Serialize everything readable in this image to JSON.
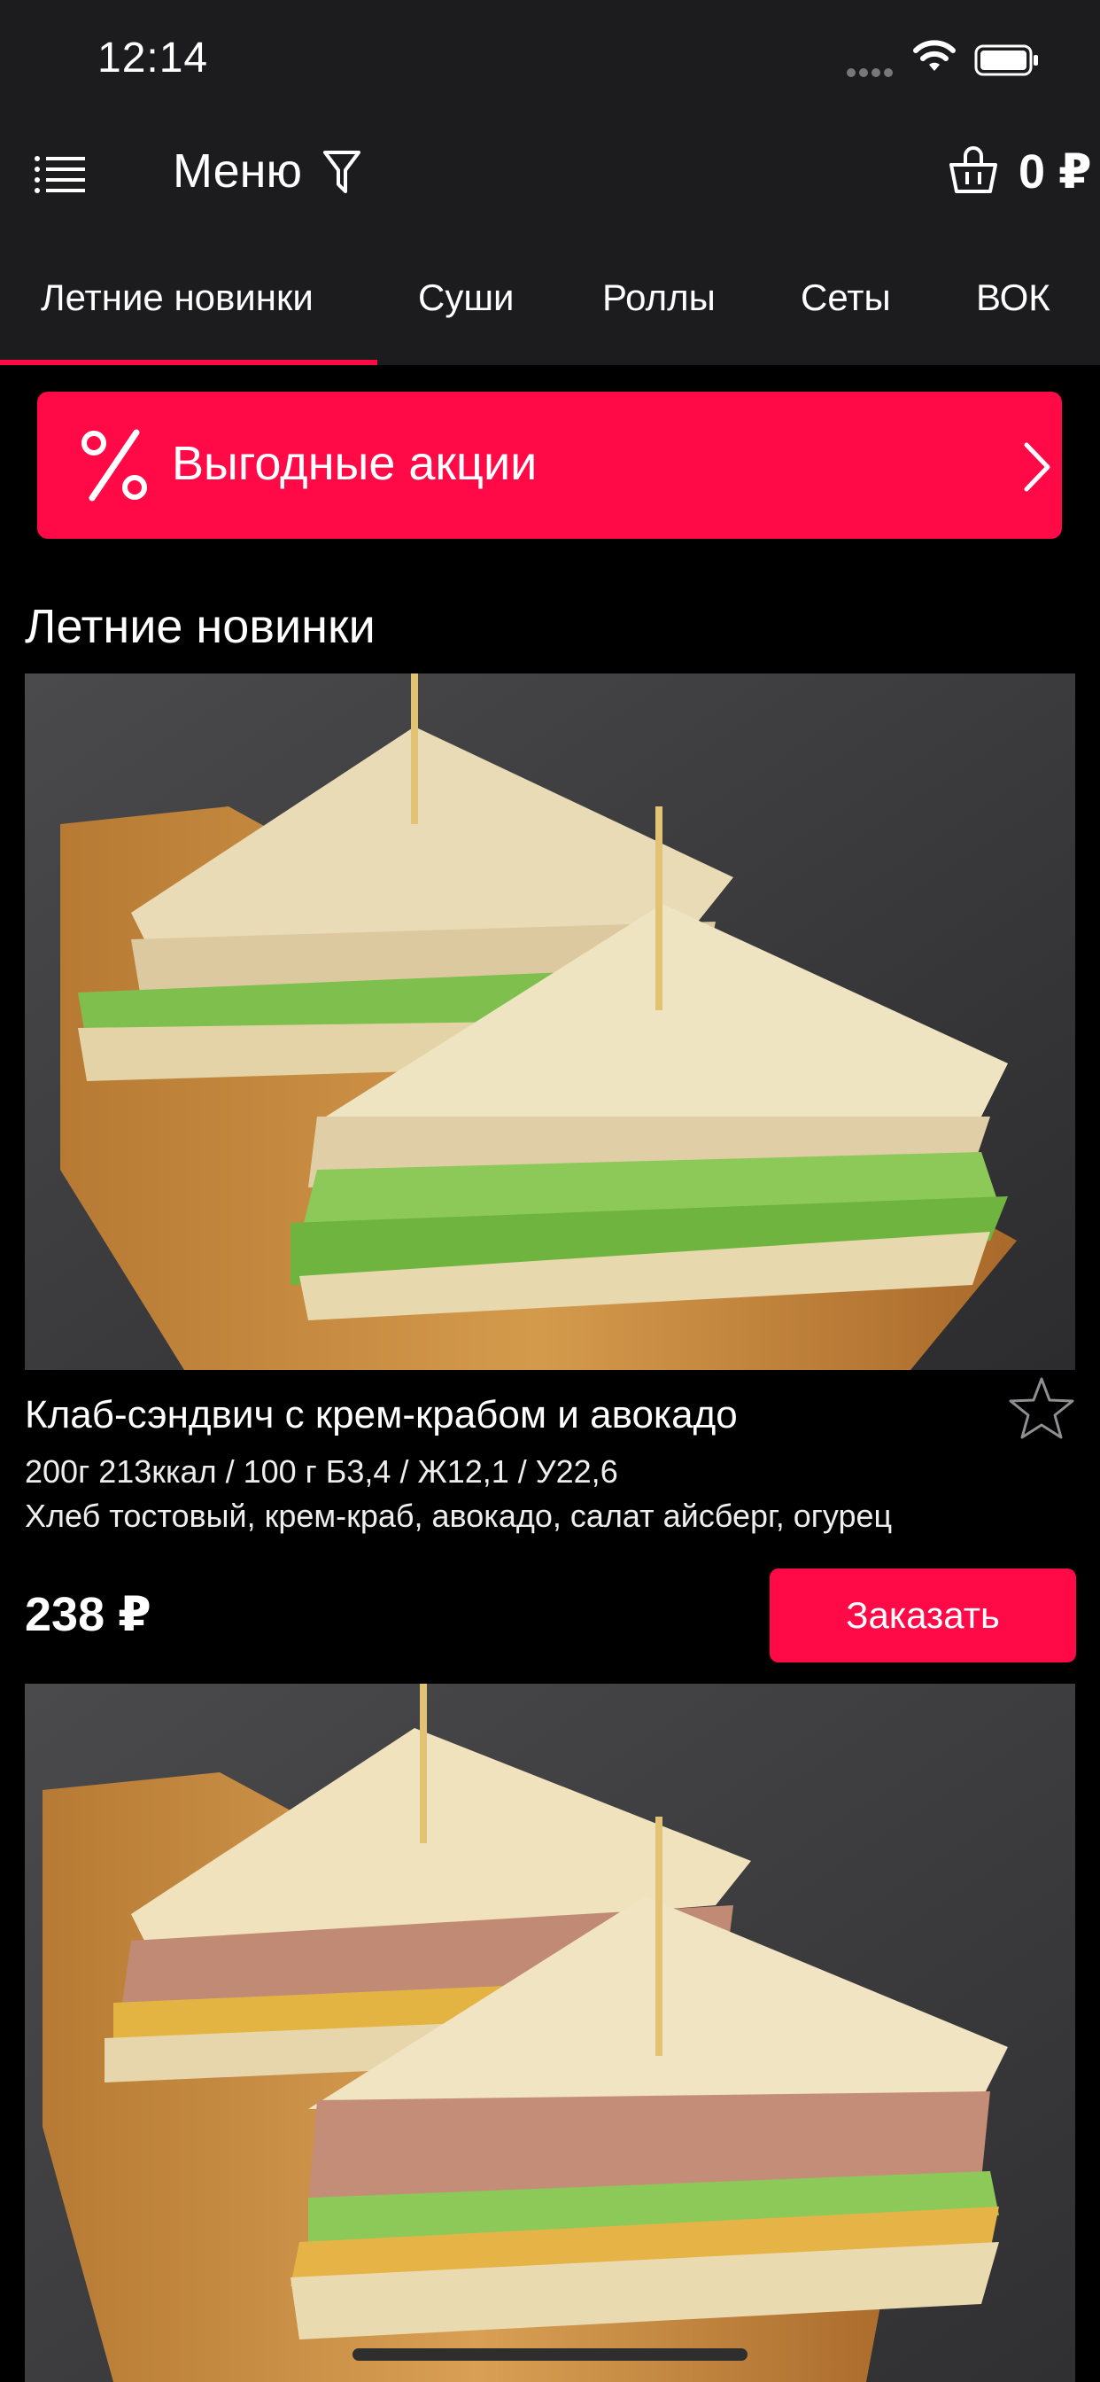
{
  "status_bar": {
    "time": "12:14"
  },
  "nav": {
    "title": "Меню",
    "cart_total": "0 ₽"
  },
  "tabs": [
    {
      "label": "Летние новинки",
      "active": true
    },
    {
      "label": "Суши"
    },
    {
      "label": "Роллы"
    },
    {
      "label": "Сеты"
    },
    {
      "label": "ВОК"
    }
  ],
  "promo": {
    "label": "Выгодные акции"
  },
  "section": {
    "title": "Летние новинки"
  },
  "products": [
    {
      "name": "Клаб-сэндвич с крем-крабом и авокадо",
      "meta": "200г 213ккал / 100 г Б3,4 / Ж12,1 / У22,6",
      "description": "Хлеб тостовый, крем-краб, авокадо, салат айсберг, огурец",
      "price": "238 ₽",
      "order_label": "Заказать",
      "favorite": false
    },
    {
      "name": "",
      "favorite": false
    }
  ],
  "colors": {
    "accent": "#ff0a47",
    "bar_background": "#1c1c1e",
    "background": "#000000"
  },
  "icons": [
    "menu-list-icon",
    "filter-icon",
    "basket-icon",
    "percent-icon",
    "chevron-right-icon",
    "star-outline-icon",
    "wifi-icon",
    "battery-icon",
    "signal-icon"
  ]
}
